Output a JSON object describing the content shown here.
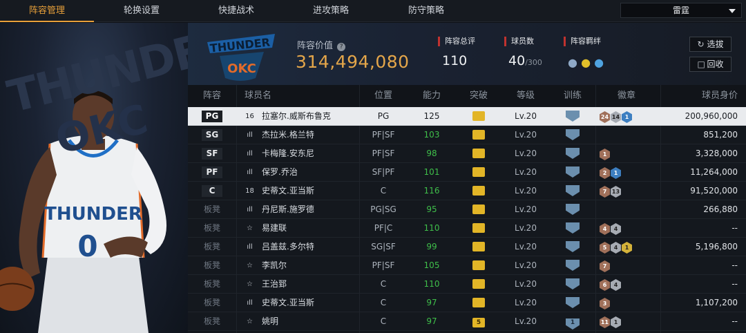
{
  "nav": {
    "tabs": [
      {
        "label": "阵容管理",
        "active": true
      },
      {
        "label": "轮换设置",
        "active": false
      },
      {
        "label": "快捷战术",
        "active": false
      },
      {
        "label": "进攻策略",
        "active": false
      },
      {
        "label": "防守策略",
        "active": false
      }
    ],
    "team_select": "雷霆"
  },
  "art": {
    "bg_text": "THUNDER",
    "bg_text2": "OKC",
    "jersey_text": "THUNDER",
    "jersey_number": "0"
  },
  "header": {
    "logo_text": "THUNDER",
    "logo_okc": "OKC",
    "value_label": "阵容价值",
    "value": "314,494,080",
    "rating_label": "阵容总评",
    "rating": "110",
    "count_label": "球员数",
    "count": "40",
    "count_max": "/300",
    "bond_label": "阵容羁绊",
    "select_button": "选拔",
    "recycle_button": "回收"
  },
  "table": {
    "headers": [
      "阵容",
      "球员名",
      "位置",
      "能力",
      "突破",
      "等级",
      "训练",
      "徽章",
      "球员身价"
    ],
    "rows": [
      {
        "slot": "PG",
        "starter": true,
        "jersey": "16",
        "name": "拉塞尔.威斯布鲁克",
        "pos": "PG",
        "ovr": "125",
        "green": false,
        "break": "",
        "level": "Lv.20",
        "train": "",
        "badges": [
          {
            "n": "24",
            "c": "bronze"
          },
          {
            "n": "14",
            "c": "silver"
          },
          {
            "n": "1",
            "c": "blue"
          }
        ],
        "price": "200,960,000"
      },
      {
        "slot": "SG",
        "starter": true,
        "jersey": "ıll",
        "name": "杰拉米.格兰特",
        "pos": "PF|SF",
        "ovr": "103",
        "green": true,
        "break": "",
        "level": "Lv.20",
        "train": "",
        "badges": [],
        "price": "851,200"
      },
      {
        "slot": "SF",
        "starter": true,
        "jersey": "ıll",
        "name": "卡梅隆.安东尼",
        "pos": "PF|SF",
        "ovr": "98",
        "green": true,
        "break": "",
        "level": "Lv.20",
        "train": "",
        "badges": [
          {
            "n": "1",
            "c": "bronze"
          }
        ],
        "price": "3,328,000"
      },
      {
        "slot": "PF",
        "starter": true,
        "jersey": "ıll",
        "name": "保罗.乔治",
        "pos": "SF|PF",
        "ovr": "101",
        "green": true,
        "break": "",
        "level": "Lv.20",
        "train": "",
        "badges": [
          {
            "n": "2",
            "c": "bronze"
          },
          {
            "n": "1",
            "c": "blue"
          }
        ],
        "price": "11,264,000"
      },
      {
        "slot": "C",
        "starter": true,
        "jersey": "18",
        "name": "史蒂文.亚当斯",
        "pos": "C",
        "ovr": "116",
        "green": true,
        "break": "",
        "level": "Lv.20",
        "train": "",
        "badges": [
          {
            "n": "7",
            "c": "bronze"
          },
          {
            "n": "13",
            "c": "silver"
          }
        ],
        "price": "91,520,000"
      },
      {
        "slot": "板凳",
        "starter": false,
        "jersey": "ıll",
        "name": "丹尼斯.施罗德",
        "pos": "PG|SG",
        "ovr": "95",
        "green": true,
        "break": "",
        "level": "Lv.20",
        "train": "",
        "badges": [],
        "price": "266,880"
      },
      {
        "slot": "板凳",
        "starter": false,
        "jersey": "☆",
        "name": "易建联",
        "pos": "PF|C",
        "ovr": "110",
        "green": true,
        "break": "",
        "level": "Lv.20",
        "train": "",
        "badges": [
          {
            "n": "4",
            "c": "bronze"
          },
          {
            "n": "4",
            "c": "silver"
          }
        ],
        "price": "--"
      },
      {
        "slot": "板凳",
        "starter": false,
        "jersey": "ıll",
        "name": "吕盖兹.多尔特",
        "pos": "SG|SF",
        "ovr": "99",
        "green": true,
        "break": "",
        "level": "Lv.20",
        "train": "",
        "badges": [
          {
            "n": "5",
            "c": "bronze"
          },
          {
            "n": "4",
            "c": "silver"
          },
          {
            "n": "1",
            "c": "gold"
          }
        ],
        "price": "5,196,800"
      },
      {
        "slot": "板凳",
        "starter": false,
        "jersey": "☆",
        "name": "李凯尔",
        "pos": "PF|SF",
        "ovr": "105",
        "green": true,
        "break": "",
        "level": "Lv.20",
        "train": "",
        "badges": [
          {
            "n": "7",
            "c": "bronze"
          }
        ],
        "price": "--"
      },
      {
        "slot": "板凳",
        "starter": false,
        "jersey": "☆",
        "name": "王治郅",
        "pos": "C",
        "ovr": "110",
        "green": true,
        "break": "",
        "level": "Lv.20",
        "train": "",
        "badges": [
          {
            "n": "6",
            "c": "bronze"
          },
          {
            "n": "4",
            "c": "silver"
          }
        ],
        "price": "--"
      },
      {
        "slot": "板凳",
        "starter": false,
        "jersey": "ıll",
        "name": "史蒂文.亚当斯",
        "pos": "C",
        "ovr": "97",
        "green": true,
        "break": "",
        "level": "Lv.20",
        "train": "",
        "badges": [
          {
            "n": "3",
            "c": "bronze"
          }
        ],
        "price": "1,107,200"
      },
      {
        "slot": "板凳",
        "starter": false,
        "jersey": "☆",
        "name": "姚明",
        "pos": "C",
        "ovr": "97",
        "green": true,
        "break": "5",
        "level": "Lv.20",
        "train": "1",
        "badges": [
          {
            "n": "11",
            "c": "bronze"
          },
          {
            "n": "1",
            "c": "silver"
          }
        ],
        "price": "--"
      }
    ]
  },
  "colors": {
    "accent": "#e8a03a",
    "value": "#e4a64a",
    "green": "#3fbf4a",
    "label_bar": "#c0322f"
  }
}
